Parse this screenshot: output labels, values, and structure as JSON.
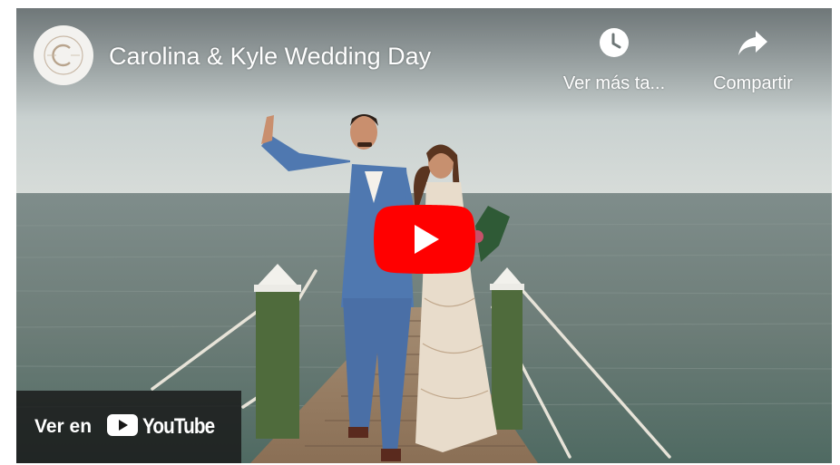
{
  "video": {
    "title": "Carolina & Kyle Wedding Day"
  },
  "actions": {
    "watch_later_label": "Ver más ta...",
    "share_label": "Compartir"
  },
  "watch_on": {
    "prefix": "Ver en",
    "brand": "YouTube"
  },
  "icons": {
    "channel": "channel-logo-icon",
    "watch_later": "clock-icon",
    "share": "share-arrow-icon",
    "play": "play-icon",
    "youtube": "youtube-logo-icon"
  },
  "colors": {
    "play_button": "#ff0000",
    "overlay_text": "#ffffff",
    "watch_on_bg": "#171717"
  }
}
